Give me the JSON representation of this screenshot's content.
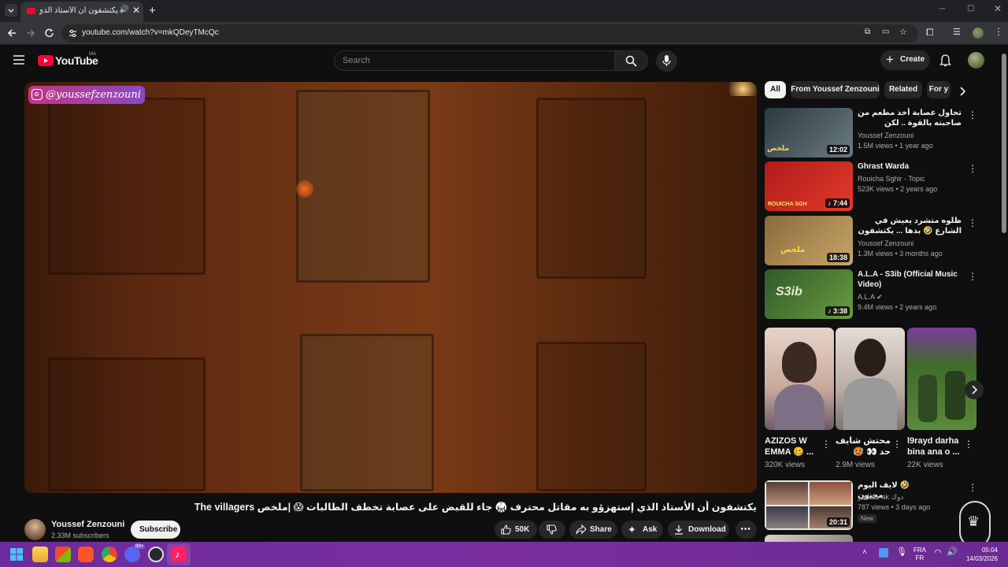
{
  "browser": {
    "tab_title": "يكتشفون أن الأستاذ الذي إستهزو",
    "url": "youtube.com/watch?v=mkQDeyTMcQc"
  },
  "header": {
    "logo_text": "YouTube",
    "region": "MA",
    "search_placeholder": "Search",
    "create_label": "Create"
  },
  "video": {
    "watermark": "@youssefzenzouni",
    "title": "The villagers يكتشفون أن الأستاذ الذي إستهزؤو به مقاتل محترف 🥋 جاء للقبض على عصابة تخطف الطالبات 😱 |ملخص",
    "channel": "Youssef Zenzouni",
    "subscribers": "2.33M subscribers",
    "subscribe_label": "Subscribe",
    "likes": "50K",
    "share_label": "Share",
    "ask_label": "Ask",
    "download_label": "Download"
  },
  "chips": [
    "All",
    "From Youssef Zenzouni",
    "Related",
    "For y"
  ],
  "recommendations": [
    {
      "title": "تحاول عصابة أخذ مطعم من صاحبته بالقوة .. لكن مافوكسوش الحارس ديالها يكون بطل",
      "channel": "Youssef Zenzouni",
      "meta": "1.5M views • 1 year ago",
      "duration": "12:02",
      "thumb_text": "ملخص",
      "colors": [
        "#2a3a3f",
        "#6b7b82"
      ]
    },
    {
      "title": "Ghrast Warda",
      "channel": "Rouicha Sghir - Topic",
      "meta": "523K views • 2 years ago",
      "duration": "7:44",
      "thumb_text": "ROUICHA SGH",
      "colors": [
        "#b01b1b",
        "#e23a2a"
      ]
    },
    {
      "title": "ظلوه متشرد يعيش في الشارع 🤣 بدها ... يكتشفون انه عميل سري يبحث في قضية",
      "channel": "Youssef Zenzouni",
      "meta": "1.3M views • 3 months ago",
      "duration": "18:38",
      "thumb_text": "ملخص",
      "colors": [
        "#8a6a3a",
        "#c8a66a"
      ]
    },
    {
      "title": "A.L.A - S3ib (Official Music Video)",
      "channel": "A.L.A",
      "meta": "9.4M views • 2 years ago",
      "duration": "3:38",
      "thumb_text": "S3ib",
      "colors": [
        "#2f5a2a",
        "#6c9b3f"
      ]
    }
  ],
  "shorts": [
    {
      "title": "AZIZOS W EMMA 🥴 ...",
      "views": "320K views",
      "colors": [
        "#c9a89a",
        "#e6d4c8"
      ]
    },
    {
      "title": "محتش شايف حد 👀 🥵",
      "views": "2.9M views",
      "colors": [
        "#d9cfc8",
        "#7d7470"
      ]
    },
    {
      "title": "l9rayd darha bina ana o ...",
      "views": "22K views",
      "colors": [
        "#3f6a2a",
        "#7a3aa0"
      ]
    }
  ],
  "bottom_rec": {
    "title": "🤣 لايف اليوم مجنون",
    "channel": "مشاهير ak دوك",
    "meta": "787 views • 3 days ago",
    "badge": "New",
    "duration": "20:31"
  },
  "taskbar": {
    "lang_top": "FRA",
    "lang_bottom": "FR",
    "time": "05:04",
    "date": "14/03/2026",
    "badge": "99+"
  }
}
